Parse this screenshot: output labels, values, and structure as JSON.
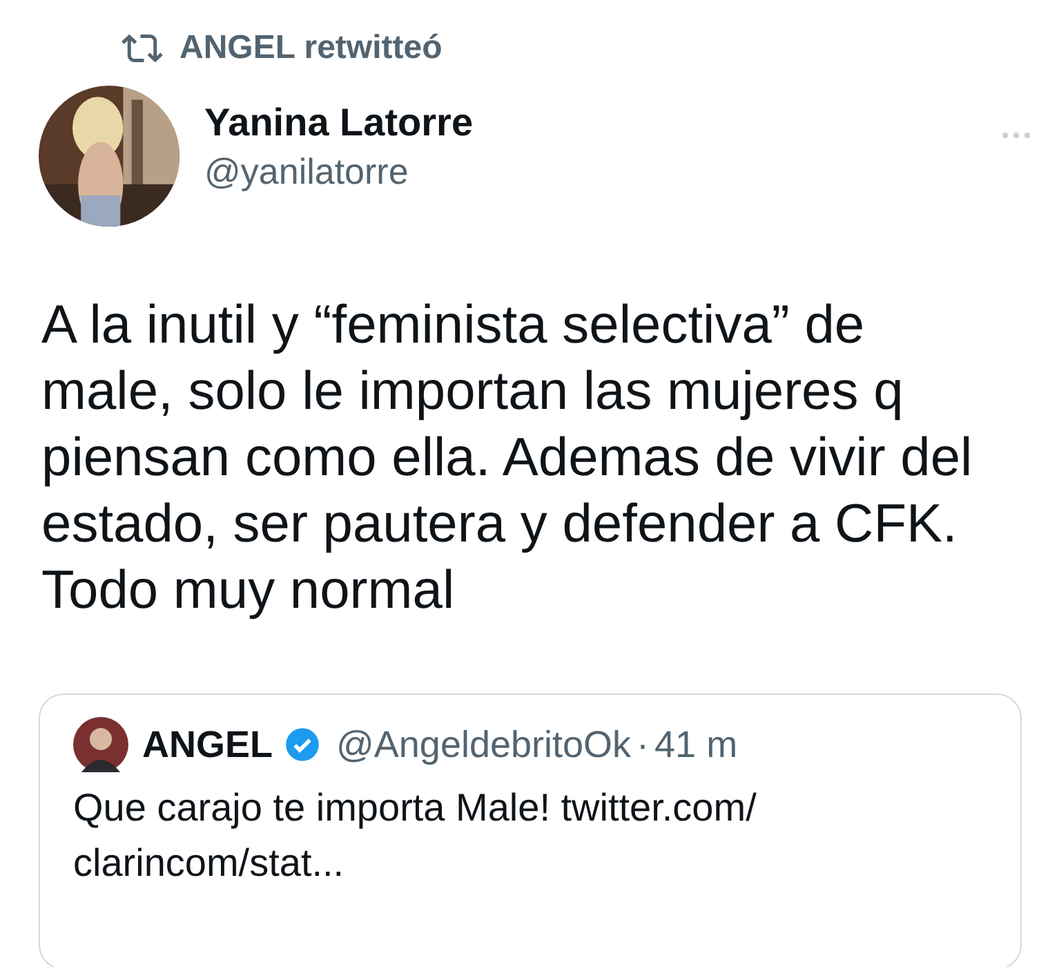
{
  "retweet_banner": {
    "text": "ANGEL retwitteó"
  },
  "tweet": {
    "author_name": "Yanina Latorre",
    "author_handle": "@yanilatorre",
    "text": "A la inutil y “feminista selectiva” de male, solo le importan las mujeres q piensan como ella. Ademas de vivir del estado, ser pautera y defender a CFK. Todo muy normal"
  },
  "quoted_tweet": {
    "author_name": "ANGEL",
    "verified": true,
    "author_handle": "@AngeldebritoOk",
    "separator": "·",
    "time": "41 m",
    "text": "Que carajo te importa Male! twitter.com/ clarincom/stat..."
  }
}
